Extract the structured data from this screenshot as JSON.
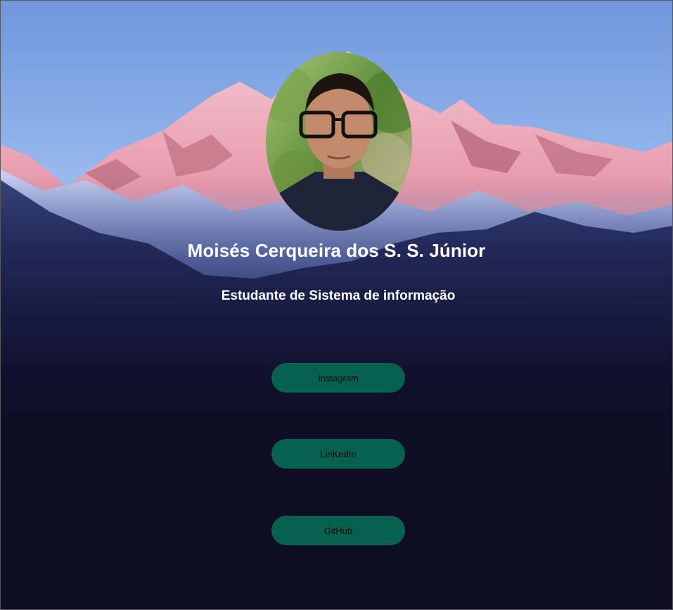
{
  "profile": {
    "name": "Moisés Cerqueira dos S. S. Júnior",
    "subtitle": "Estudante de Sistema de informação"
  },
  "links": [
    {
      "label": "Instagram"
    },
    {
      "label": "LinKedIn"
    },
    {
      "label": "GitHub"
    }
  ],
  "colors": {
    "button_bg": "#07614f",
    "button_text": "#0a0a0a",
    "page_bg": "#0e0d24",
    "heading_text": "#ffffff"
  }
}
